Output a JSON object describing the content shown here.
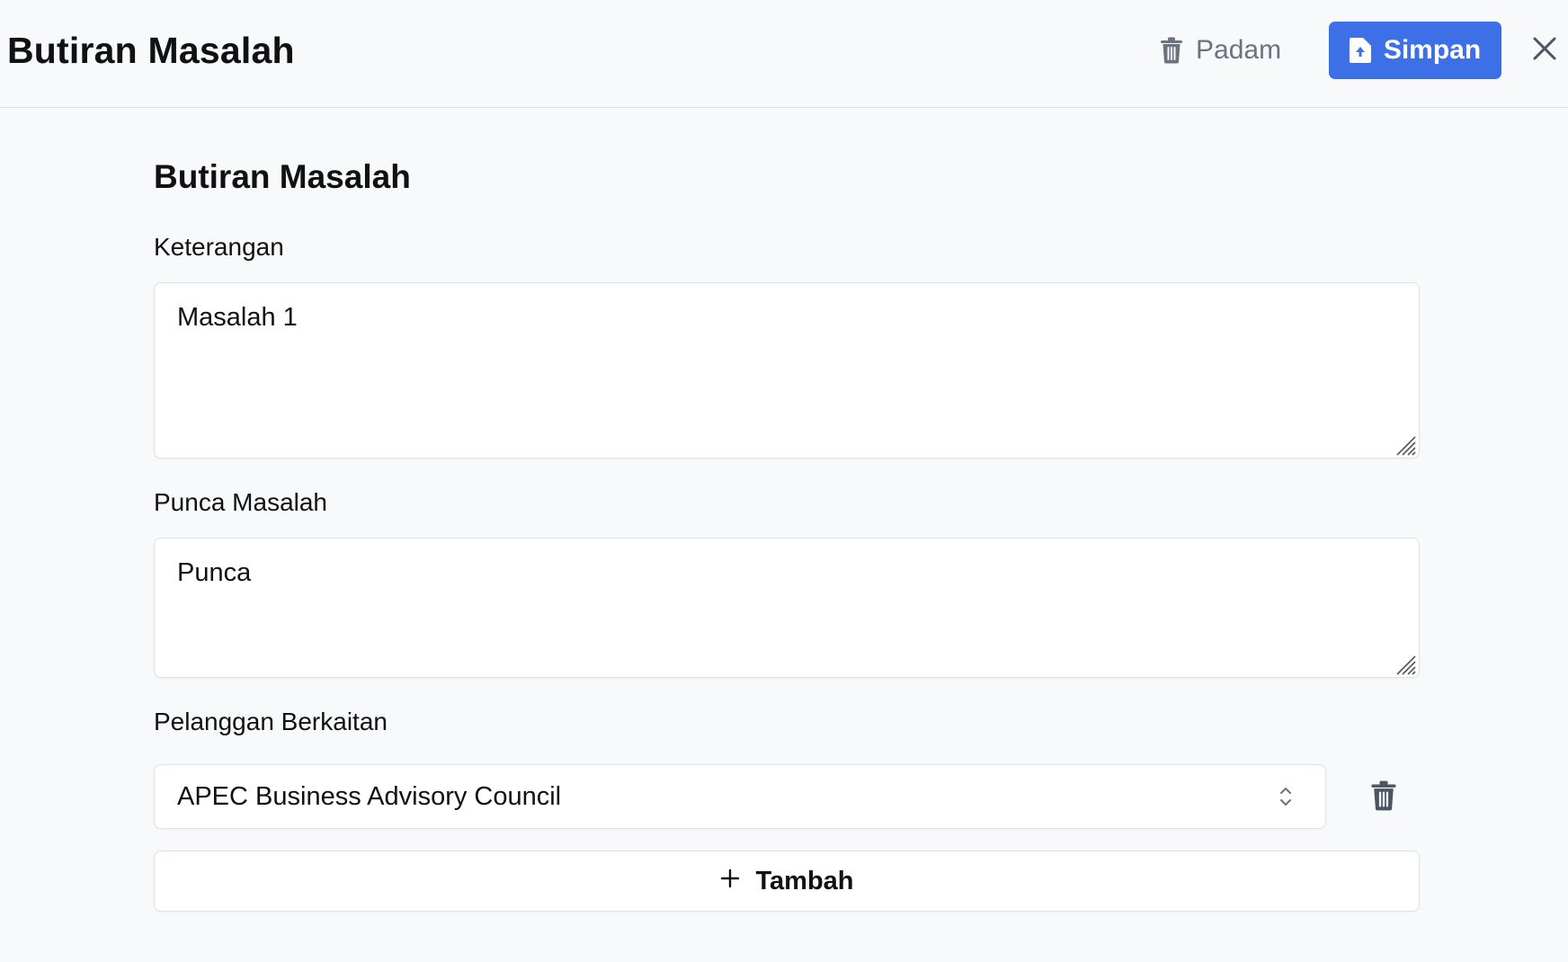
{
  "header": {
    "title": "Butiran Masalah",
    "delete_label": "Padam",
    "save_label": "Simpan",
    "accent_color": "#3d6fe6"
  },
  "form": {
    "section_title": "Butiran Masalah",
    "keterangan": {
      "label": "Keterangan",
      "value": "Masalah 1"
    },
    "punca": {
      "label": "Punca Masalah",
      "value": "Punca"
    },
    "pelanggan": {
      "label": "Pelanggan Berkaitan",
      "items": [
        {
          "value": "APEC Business Advisory Council"
        }
      ],
      "add_label": "Tambah"
    }
  },
  "icons": {
    "delete": "trash-icon",
    "save": "document-upload-icon",
    "close": "close-icon",
    "select": "chevron-updown-icon",
    "add": "plus-icon"
  }
}
